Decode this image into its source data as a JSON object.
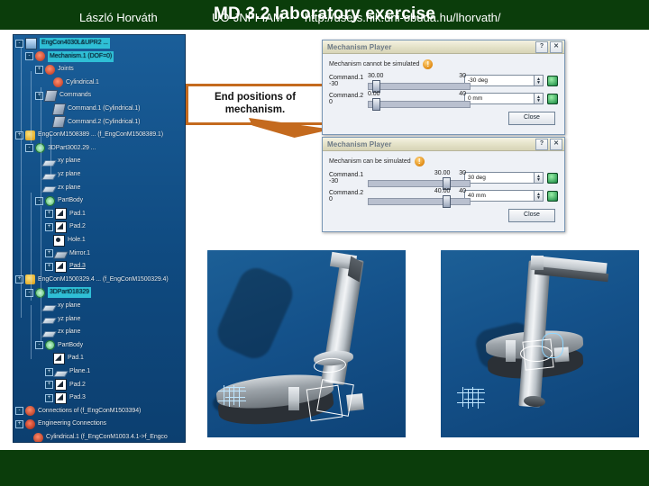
{
  "slide": {
    "title": "MD 3.2 laboratory exercise",
    "header_color": "#0b3d0b",
    "footer": {
      "author": "László Horváth",
      "organization": "UÓ-JNFI-IAM",
      "url": "http://users.nik.uni-obuda.hu/lhorvath/"
    }
  },
  "callout": {
    "line1": "End positions of",
    "line2": "mechanism.",
    "border_color": "#c46a1e"
  },
  "tree": {
    "title": "specification-tree",
    "background_color": "#14538c",
    "selected_color": "#2fbfd6",
    "nodes": [
      {
        "label": "EngCon4030L&UPR2 ...",
        "icon": "document-icon",
        "indent": 0,
        "expander": "-",
        "selected": true,
        "underline": false
      },
      {
        "label": "Mechanism.1 (DOF=0)",
        "icon": "joint-icon",
        "indent": 1,
        "expander": "-",
        "selected": true,
        "underline": false
      },
      {
        "label": "Joints",
        "icon": "joint-icon",
        "indent": 2,
        "expander": "+",
        "selected": false,
        "underline": false
      },
      {
        "label": "Cylindrical.1",
        "icon": "joint-icon",
        "indent": 3,
        "expander": "",
        "selected": false,
        "underline": false
      },
      {
        "label": "Commands",
        "icon": "command-icon",
        "indent": 2,
        "expander": "+",
        "selected": false,
        "underline": false
      },
      {
        "label": "Command.1 (Cylindrical.1)",
        "icon": "command-icon",
        "indent": 3,
        "expander": "",
        "selected": false,
        "underline": false
      },
      {
        "label": "Command.2 (Cylindrical.1)",
        "icon": "command-icon",
        "indent": 3,
        "expander": "",
        "selected": false,
        "underline": false
      },
      {
        "label": "EngConM1508389 ... (f_EngConM1508389.1)",
        "icon": "product-icon",
        "indent": 0,
        "expander": "+",
        "selected": false,
        "underline": false
      },
      {
        "label": "3DPart3002.29 ...",
        "icon": "gear-icon",
        "indent": 1,
        "expander": "-",
        "selected": false,
        "underline": false
      },
      {
        "label": "xy plane",
        "icon": "plane-icon",
        "indent": 2,
        "expander": "",
        "selected": false,
        "underline": false
      },
      {
        "label": "yz plane",
        "icon": "plane-icon",
        "indent": 2,
        "expander": "",
        "selected": false,
        "underline": false
      },
      {
        "label": "zx plane",
        "icon": "plane-icon",
        "indent": 2,
        "expander": "",
        "selected": false,
        "underline": false
      },
      {
        "label": "PartBody",
        "icon": "gear-icon",
        "indent": 2,
        "expander": "-",
        "selected": false,
        "underline": false
      },
      {
        "label": "Pad.1",
        "icon": "pad-icon",
        "indent": 3,
        "expander": "+",
        "selected": false,
        "underline": false
      },
      {
        "label": "Pad.2",
        "icon": "pad-icon",
        "indent": 3,
        "expander": "+",
        "selected": false,
        "underline": false
      },
      {
        "label": "Hole.1",
        "icon": "hole-icon",
        "indent": 3,
        "expander": "",
        "selected": false,
        "underline": false
      },
      {
        "label": "Mirror.1",
        "icon": "mirror-icon",
        "indent": 3,
        "expander": "+",
        "selected": false,
        "underline": false
      },
      {
        "label": "Pad.3",
        "icon": "pad-icon",
        "indent": 3,
        "expander": "+",
        "selected": false,
        "underline": true
      },
      {
        "label": "EngConM1500329.4 ... (f_EngConM1500329.4)",
        "icon": "product-icon",
        "indent": 0,
        "expander": "+",
        "selected": false,
        "underline": false
      },
      {
        "label": "3DPart018329",
        "icon": "gear-icon",
        "indent": 1,
        "expander": "-",
        "selected": true,
        "underline": false
      },
      {
        "label": "xy plane",
        "icon": "plane-icon",
        "indent": 2,
        "expander": "",
        "selected": false,
        "underline": false
      },
      {
        "label": "yz plane",
        "icon": "plane-icon",
        "indent": 2,
        "expander": "",
        "selected": false,
        "underline": false
      },
      {
        "label": "zx plane",
        "icon": "plane-icon",
        "indent": 2,
        "expander": "",
        "selected": false,
        "underline": false
      },
      {
        "label": "PartBody",
        "icon": "gear-icon",
        "indent": 2,
        "expander": "-",
        "selected": false,
        "underline": false
      },
      {
        "label": "Pad.1",
        "icon": "pad-icon",
        "indent": 3,
        "expander": "",
        "selected": false,
        "underline": false
      },
      {
        "label": "Plane.1",
        "icon": "plane-icon",
        "indent": 3,
        "expander": "+",
        "selected": false,
        "underline": false
      },
      {
        "label": "Pad.2",
        "icon": "pad-icon",
        "indent": 3,
        "expander": "+",
        "selected": false,
        "underline": false
      },
      {
        "label": "Pad.3",
        "icon": "pad-icon",
        "indent": 3,
        "expander": "+",
        "selected": false,
        "underline": false
      },
      {
        "label": "Connections of (f_EngConM1503394)",
        "icon": "connection-icon",
        "indent": 0,
        "expander": "-",
        "selected": false,
        "underline": false
      },
      {
        "label": "Engineering Connections",
        "icon": "engineering-icon",
        "indent": 0,
        "expander": "+",
        "selected": false,
        "underline": false
      },
      {
        "label": "Cylindrical.1 (f_EngConM1003.4.1->f_Engco",
        "icon": "connection-icon",
        "indent": 1,
        "expander": "",
        "selected": false,
        "underline": false
      }
    ]
  },
  "dialogs": [
    {
      "id": "mechanism-player-1",
      "title": "Mechanism Player",
      "help_button": "?",
      "close_button": "✕",
      "warning_text": "Mechanism cannot be simulated",
      "warning_icon": "!",
      "commands": [
        {
          "name": "Command.1",
          "min": "-30",
          "value_label": "30.00",
          "max": "30",
          "unit": "-30 deg",
          "thumb_pct": 6
        },
        {
          "name": "Command.2",
          "min": "0",
          "value_label": "0.00",
          "max": "40",
          "unit": "0 mm",
          "thumb_pct": 6
        }
      ],
      "close_label": "Close"
    },
    {
      "id": "mechanism-player-2",
      "title": "Mechanism Player",
      "help_button": "?",
      "close_button": "✕",
      "warning_text": "Mechanism can be simulated",
      "warning_icon": "!",
      "commands": [
        {
          "name": "Command.1",
          "min": "-30",
          "value_label": "30.00",
          "max": "30",
          "unit": "30 deg",
          "thumb_pct": 93
        },
        {
          "name": "Command.2",
          "min": "0",
          "value_label": "40.00",
          "max": "40",
          "unit": "40 mm",
          "thumb_pct": 93
        }
      ],
      "close_label": "Close"
    }
  ],
  "viewports": [
    {
      "id": "viewport-start-position",
      "name": "mechanism-start-position",
      "background_color": "#14528c",
      "axis_label": "compass-axis"
    },
    {
      "id": "viewport-end-position",
      "name": "mechanism-end-position",
      "background_color": "#14528c",
      "axis_label": "compass-axis"
    }
  ]
}
